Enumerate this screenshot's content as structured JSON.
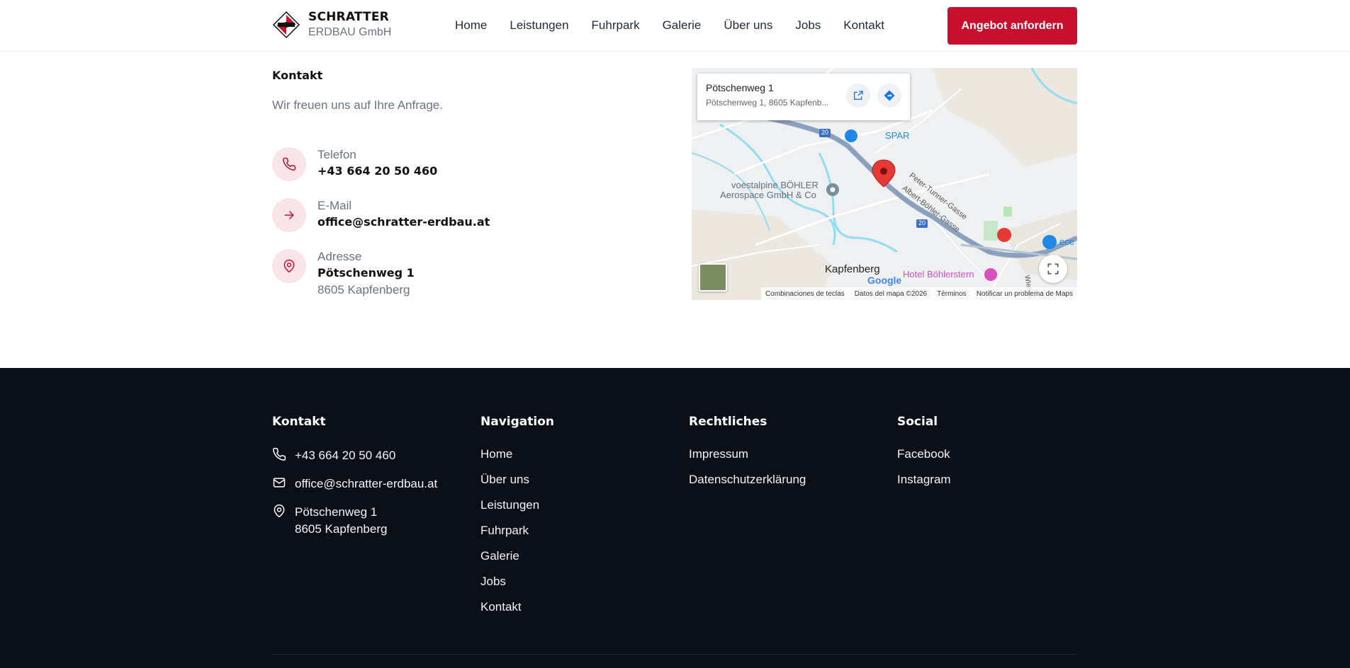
{
  "header": {
    "brand_name": "SCHRATTER",
    "brand_sub": "ERDBAU GmbH",
    "nav": [
      "Home",
      "Leistungen",
      "Fuhrpark",
      "Galerie",
      "Über uns",
      "Jobs",
      "Kontakt"
    ],
    "cta_label": "Angebot anfordern"
  },
  "contact": {
    "heading": "Kontakt",
    "subtitle": "Wir freuen uns auf Ihre Anfrage.",
    "phone_label": "Telefon",
    "phone_value": "+43 664 20 50 460",
    "email_label": "E-Mail",
    "email_value": "office@schratter-erdbau.at",
    "address_label": "Adresse",
    "address_street": "Pötschenweg 1",
    "address_city": "8605 Kapfenberg"
  },
  "map": {
    "card_title": "Pötschenweg 1",
    "card_sub": "Pötschenweg 1, 8605 Kapfenb...",
    "labels": {
      "spar": "SPAR",
      "voest1": "voestalpine BÖHLER",
      "voest2": "Aerospace GmbH & Co",
      "peter": "Peter-Tunner-Gasse",
      "albert": "Albert-Böhler-Gasse",
      "kapfenberg": "Kapfenberg",
      "hotel": "Hotel Böhlerstern",
      "ece": "ece",
      "route20": "20",
      "wiener": "Wiene"
    },
    "footer": [
      "Combinaciones de teclas",
      "Datos del mapa ©2026",
      "Términos",
      "Notificar un problema de Maps"
    ],
    "google": "Google",
    "colors": {
      "pin": "#e53935",
      "water": "#7fd6f0",
      "road": "#8aa0bf"
    }
  },
  "footer": {
    "kontakt_title": "Kontakt",
    "phone": "+43 664 20 50 460",
    "email": "office@schratter-erdbau.at",
    "street": "Pötschenweg 1",
    "city": "8605 Kapfenberg",
    "nav_title": "Navigation",
    "nav": [
      "Home",
      "Über uns",
      "Leistungen",
      "Fuhrpark",
      "Galerie",
      "Jobs",
      "Kontakt"
    ],
    "legal_title": "Rechtliches",
    "legal": [
      "Impressum",
      "Datenschutzerklärung"
    ],
    "social_title": "Social",
    "social": [
      "Facebook",
      "Instagram"
    ]
  },
  "colors": {
    "accent": "#c8102e",
    "accent_soft": "#fbe4e7",
    "footer_bg": "#0b0f17"
  }
}
